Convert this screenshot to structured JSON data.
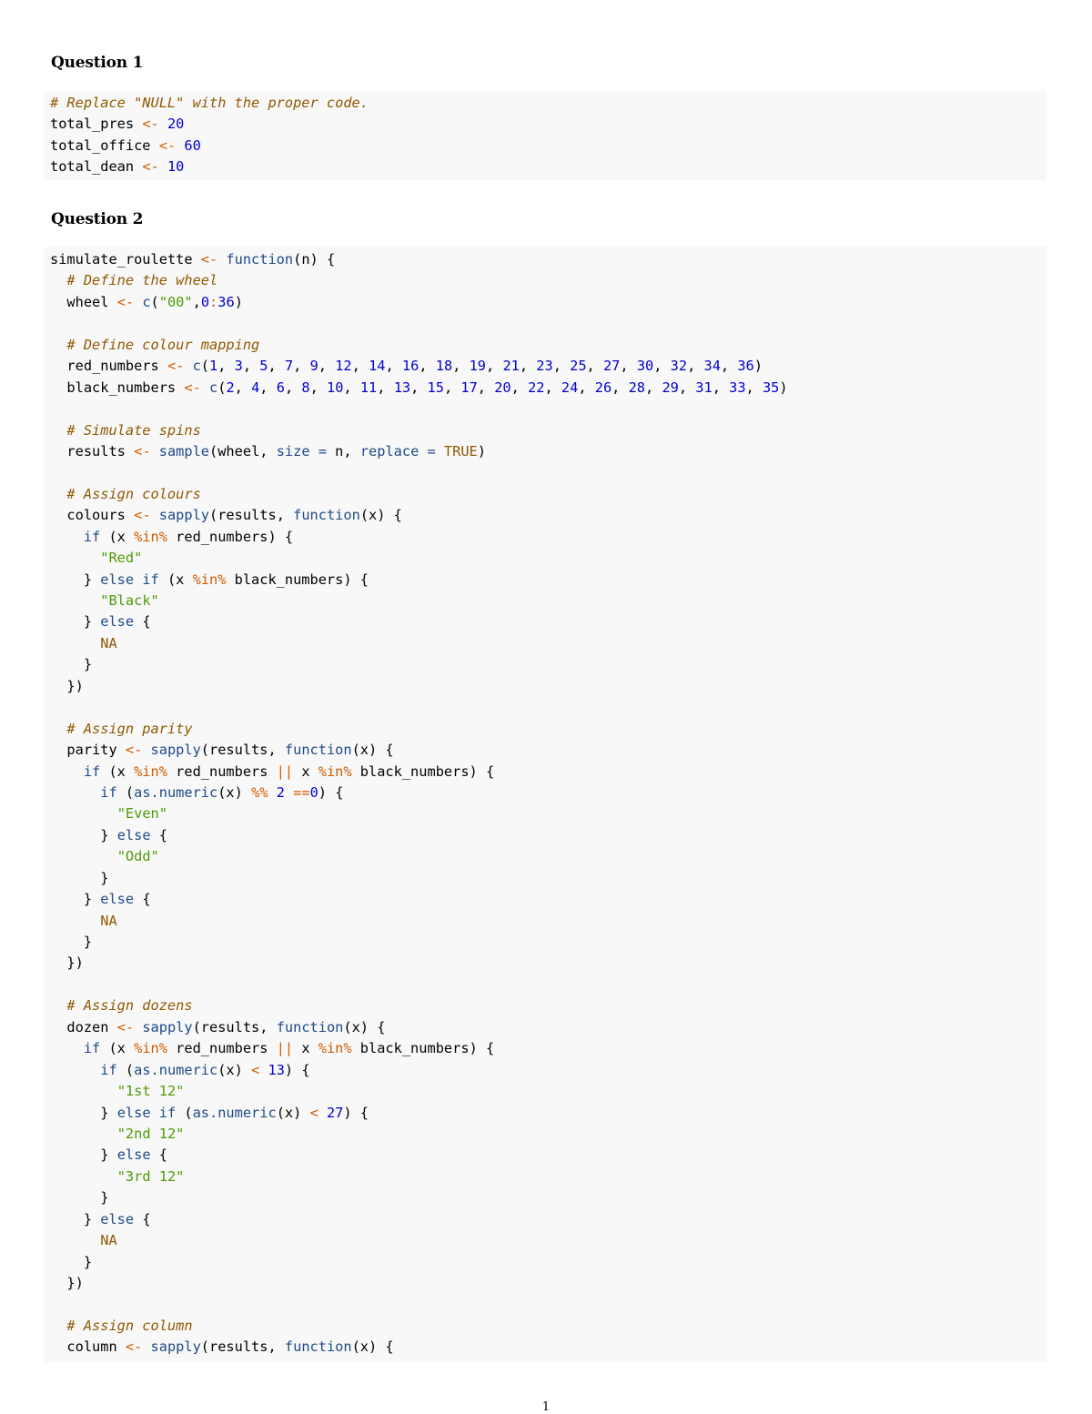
{
  "question1": {
    "heading": "Question 1",
    "code_lines": [
      [
        {
          "t": "c",
          "v": "# Replace \"NULL\" with the proper code."
        }
      ],
      [
        {
          "t": "p",
          "v": "total_pres "
        },
        {
          "t": "o",
          "v": "<-"
        },
        {
          "t": "p",
          "v": " "
        },
        {
          "t": "n",
          "v": "20"
        }
      ],
      [
        {
          "t": "p",
          "v": "total_office "
        },
        {
          "t": "o",
          "v": "<-"
        },
        {
          "t": "p",
          "v": " "
        },
        {
          "t": "n",
          "v": "60"
        }
      ],
      [
        {
          "t": "p",
          "v": "total_dean "
        },
        {
          "t": "o",
          "v": "<-"
        },
        {
          "t": "p",
          "v": " "
        },
        {
          "t": "n",
          "v": "10"
        }
      ]
    ]
  },
  "question2": {
    "heading": "Question 2",
    "code_lines": [
      [
        {
          "t": "p",
          "v": "simulate_roulette "
        },
        {
          "t": "o",
          "v": "<-"
        },
        {
          "t": "p",
          "v": " "
        },
        {
          "t": "k",
          "v": "function"
        },
        {
          "t": "p",
          "v": "(n) {"
        }
      ],
      [
        {
          "t": "p",
          "v": "  "
        },
        {
          "t": "c",
          "v": "# Define the wheel"
        }
      ],
      [
        {
          "t": "p",
          "v": "  wheel "
        },
        {
          "t": "o",
          "v": "<-"
        },
        {
          "t": "p",
          "v": " "
        },
        {
          "t": "f",
          "v": "c"
        },
        {
          "t": "p",
          "v": "("
        },
        {
          "t": "s",
          "v": "\"00\""
        },
        {
          "t": "p",
          "v": ","
        },
        {
          "t": "n",
          "v": "0"
        },
        {
          "t": "o",
          "v": ":"
        },
        {
          "t": "n",
          "v": "36"
        },
        {
          "t": "p",
          "v": ")"
        }
      ],
      [],
      [
        {
          "t": "p",
          "v": "  "
        },
        {
          "t": "c",
          "v": "# Define colour mapping"
        }
      ],
      [
        {
          "t": "p",
          "v": "  red_numbers "
        },
        {
          "t": "o",
          "v": "<-"
        },
        {
          "t": "p",
          "v": " "
        },
        {
          "t": "f",
          "v": "c"
        },
        {
          "t": "p",
          "v": "("
        },
        {
          "t": "n",
          "v": "1"
        },
        {
          "t": "p",
          "v": ", "
        },
        {
          "t": "n",
          "v": "3"
        },
        {
          "t": "p",
          "v": ", "
        },
        {
          "t": "n",
          "v": "5"
        },
        {
          "t": "p",
          "v": ", "
        },
        {
          "t": "n",
          "v": "7"
        },
        {
          "t": "p",
          "v": ", "
        },
        {
          "t": "n",
          "v": "9"
        },
        {
          "t": "p",
          "v": ", "
        },
        {
          "t": "n",
          "v": "12"
        },
        {
          "t": "p",
          "v": ", "
        },
        {
          "t": "n",
          "v": "14"
        },
        {
          "t": "p",
          "v": ", "
        },
        {
          "t": "n",
          "v": "16"
        },
        {
          "t": "p",
          "v": ", "
        },
        {
          "t": "n",
          "v": "18"
        },
        {
          "t": "p",
          "v": ", "
        },
        {
          "t": "n",
          "v": "19"
        },
        {
          "t": "p",
          "v": ", "
        },
        {
          "t": "n",
          "v": "21"
        },
        {
          "t": "p",
          "v": ", "
        },
        {
          "t": "n",
          "v": "23"
        },
        {
          "t": "p",
          "v": ", "
        },
        {
          "t": "n",
          "v": "25"
        },
        {
          "t": "p",
          "v": ", "
        },
        {
          "t": "n",
          "v": "27"
        },
        {
          "t": "p",
          "v": ", "
        },
        {
          "t": "n",
          "v": "30"
        },
        {
          "t": "p",
          "v": ", "
        },
        {
          "t": "n",
          "v": "32"
        },
        {
          "t": "p",
          "v": ", "
        },
        {
          "t": "n",
          "v": "34"
        },
        {
          "t": "p",
          "v": ", "
        },
        {
          "t": "n",
          "v": "36"
        },
        {
          "t": "p",
          "v": ")"
        }
      ],
      [
        {
          "t": "p",
          "v": "  black_numbers "
        },
        {
          "t": "o",
          "v": "<-"
        },
        {
          "t": "p",
          "v": " "
        },
        {
          "t": "f",
          "v": "c"
        },
        {
          "t": "p",
          "v": "("
        },
        {
          "t": "n",
          "v": "2"
        },
        {
          "t": "p",
          "v": ", "
        },
        {
          "t": "n",
          "v": "4"
        },
        {
          "t": "p",
          "v": ", "
        },
        {
          "t": "n",
          "v": "6"
        },
        {
          "t": "p",
          "v": ", "
        },
        {
          "t": "n",
          "v": "8"
        },
        {
          "t": "p",
          "v": ", "
        },
        {
          "t": "n",
          "v": "10"
        },
        {
          "t": "p",
          "v": ", "
        },
        {
          "t": "n",
          "v": "11"
        },
        {
          "t": "p",
          "v": ", "
        },
        {
          "t": "n",
          "v": "13"
        },
        {
          "t": "p",
          "v": ", "
        },
        {
          "t": "n",
          "v": "15"
        },
        {
          "t": "p",
          "v": ", "
        },
        {
          "t": "n",
          "v": "17"
        },
        {
          "t": "p",
          "v": ", "
        },
        {
          "t": "n",
          "v": "20"
        },
        {
          "t": "p",
          "v": ", "
        },
        {
          "t": "n",
          "v": "22"
        },
        {
          "t": "p",
          "v": ", "
        },
        {
          "t": "n",
          "v": "24"
        },
        {
          "t": "p",
          "v": ", "
        },
        {
          "t": "n",
          "v": "26"
        },
        {
          "t": "p",
          "v": ", "
        },
        {
          "t": "n",
          "v": "28"
        },
        {
          "t": "p",
          "v": ", "
        },
        {
          "t": "n",
          "v": "29"
        },
        {
          "t": "p",
          "v": ", "
        },
        {
          "t": "n",
          "v": "31"
        },
        {
          "t": "p",
          "v": ", "
        },
        {
          "t": "n",
          "v": "33"
        },
        {
          "t": "p",
          "v": ", "
        },
        {
          "t": "n",
          "v": "35"
        },
        {
          "t": "p",
          "v": ")"
        }
      ],
      [],
      [
        {
          "t": "p",
          "v": "  "
        },
        {
          "t": "c",
          "v": "# Simulate spins"
        }
      ],
      [
        {
          "t": "p",
          "v": "  results "
        },
        {
          "t": "o",
          "v": "<-"
        },
        {
          "t": "p",
          "v": " "
        },
        {
          "t": "f",
          "v": "sample"
        },
        {
          "t": "p",
          "v": "(wheel, "
        },
        {
          "t": "a",
          "v": "size ="
        },
        {
          "t": "p",
          "v": " n, "
        },
        {
          "t": "a",
          "v": "replace ="
        },
        {
          "t": "p",
          "v": " "
        },
        {
          "t": "t",
          "v": "TRUE"
        },
        {
          "t": "p",
          "v": ")"
        }
      ],
      [],
      [
        {
          "t": "p",
          "v": "  "
        },
        {
          "t": "c",
          "v": "# Assign colours"
        }
      ],
      [
        {
          "t": "p",
          "v": "  colours "
        },
        {
          "t": "o",
          "v": "<-"
        },
        {
          "t": "p",
          "v": " "
        },
        {
          "t": "f",
          "v": "sapply"
        },
        {
          "t": "p",
          "v": "(results, "
        },
        {
          "t": "k",
          "v": "function"
        },
        {
          "t": "p",
          "v": "(x) {"
        }
      ],
      [
        {
          "t": "p",
          "v": "    "
        },
        {
          "t": "k",
          "v": "if"
        },
        {
          "t": "p",
          "v": " (x "
        },
        {
          "t": "o",
          "v": "%in%"
        },
        {
          "t": "p",
          "v": " red_numbers) {"
        }
      ],
      [
        {
          "t": "p",
          "v": "      "
        },
        {
          "t": "s",
          "v": "\"Red\""
        }
      ],
      [
        {
          "t": "p",
          "v": "    } "
        },
        {
          "t": "k",
          "v": "else if"
        },
        {
          "t": "p",
          "v": " (x "
        },
        {
          "t": "o",
          "v": "%in%"
        },
        {
          "t": "p",
          "v": " black_numbers) {"
        }
      ],
      [
        {
          "t": "p",
          "v": "      "
        },
        {
          "t": "s",
          "v": "\"Black\""
        }
      ],
      [
        {
          "t": "p",
          "v": "    } "
        },
        {
          "t": "k",
          "v": "else"
        },
        {
          "t": "p",
          "v": " {"
        }
      ],
      [
        {
          "t": "p",
          "v": "      "
        },
        {
          "t": "na",
          "v": "NA"
        }
      ],
      [
        {
          "t": "p",
          "v": "    }"
        }
      ],
      [
        {
          "t": "p",
          "v": "  })"
        }
      ],
      [],
      [
        {
          "t": "p",
          "v": "  "
        },
        {
          "t": "c",
          "v": "# Assign parity"
        }
      ],
      [
        {
          "t": "p",
          "v": "  parity "
        },
        {
          "t": "o",
          "v": "<-"
        },
        {
          "t": "p",
          "v": " "
        },
        {
          "t": "f",
          "v": "sapply"
        },
        {
          "t": "p",
          "v": "(results, "
        },
        {
          "t": "k",
          "v": "function"
        },
        {
          "t": "p",
          "v": "(x) {"
        }
      ],
      [
        {
          "t": "p",
          "v": "    "
        },
        {
          "t": "k",
          "v": "if"
        },
        {
          "t": "p",
          "v": " (x "
        },
        {
          "t": "o",
          "v": "%in%"
        },
        {
          "t": "p",
          "v": " red_numbers "
        },
        {
          "t": "o",
          "v": "||"
        },
        {
          "t": "p",
          "v": " x "
        },
        {
          "t": "o",
          "v": "%in%"
        },
        {
          "t": "p",
          "v": " black_numbers) {"
        }
      ],
      [
        {
          "t": "p",
          "v": "      "
        },
        {
          "t": "k",
          "v": "if"
        },
        {
          "t": "p",
          "v": " ("
        },
        {
          "t": "f",
          "v": "as.numeric"
        },
        {
          "t": "p",
          "v": "(x) "
        },
        {
          "t": "o",
          "v": "%%"
        },
        {
          "t": "p",
          "v": " "
        },
        {
          "t": "n",
          "v": "2"
        },
        {
          "t": "p",
          "v": " "
        },
        {
          "t": "o",
          "v": "=="
        },
        {
          "t": "n",
          "v": "0"
        },
        {
          "t": "p",
          "v": ") {"
        }
      ],
      [
        {
          "t": "p",
          "v": "        "
        },
        {
          "t": "s",
          "v": "\"Even\""
        }
      ],
      [
        {
          "t": "p",
          "v": "      } "
        },
        {
          "t": "k",
          "v": "else"
        },
        {
          "t": "p",
          "v": " {"
        }
      ],
      [
        {
          "t": "p",
          "v": "        "
        },
        {
          "t": "s",
          "v": "\"Odd\""
        }
      ],
      [
        {
          "t": "p",
          "v": "      }"
        }
      ],
      [
        {
          "t": "p",
          "v": "    } "
        },
        {
          "t": "k",
          "v": "else"
        },
        {
          "t": "p",
          "v": " {"
        }
      ],
      [
        {
          "t": "p",
          "v": "      "
        },
        {
          "t": "na",
          "v": "NA"
        }
      ],
      [
        {
          "t": "p",
          "v": "    }"
        }
      ],
      [
        {
          "t": "p",
          "v": "  })"
        }
      ],
      [],
      [
        {
          "t": "p",
          "v": "  "
        },
        {
          "t": "c",
          "v": "# Assign dozens"
        }
      ],
      [
        {
          "t": "p",
          "v": "  dozen "
        },
        {
          "t": "o",
          "v": "<-"
        },
        {
          "t": "p",
          "v": " "
        },
        {
          "t": "f",
          "v": "sapply"
        },
        {
          "t": "p",
          "v": "(results, "
        },
        {
          "t": "k",
          "v": "function"
        },
        {
          "t": "p",
          "v": "(x) {"
        }
      ],
      [
        {
          "t": "p",
          "v": "    "
        },
        {
          "t": "k",
          "v": "if"
        },
        {
          "t": "p",
          "v": " (x "
        },
        {
          "t": "o",
          "v": "%in%"
        },
        {
          "t": "p",
          "v": " red_numbers "
        },
        {
          "t": "o",
          "v": "||"
        },
        {
          "t": "p",
          "v": " x "
        },
        {
          "t": "o",
          "v": "%in%"
        },
        {
          "t": "p",
          "v": " black_numbers) {"
        }
      ],
      [
        {
          "t": "p",
          "v": "      "
        },
        {
          "t": "k",
          "v": "if"
        },
        {
          "t": "p",
          "v": " ("
        },
        {
          "t": "f",
          "v": "as.numeric"
        },
        {
          "t": "p",
          "v": "(x) "
        },
        {
          "t": "o",
          "v": "<"
        },
        {
          "t": "p",
          "v": " "
        },
        {
          "t": "n",
          "v": "13"
        },
        {
          "t": "p",
          "v": ") {"
        }
      ],
      [
        {
          "t": "p",
          "v": "        "
        },
        {
          "t": "s",
          "v": "\"1st 12\""
        }
      ],
      [
        {
          "t": "p",
          "v": "      } "
        },
        {
          "t": "k",
          "v": "else if"
        },
        {
          "t": "p",
          "v": " ("
        },
        {
          "t": "f",
          "v": "as.numeric"
        },
        {
          "t": "p",
          "v": "(x) "
        },
        {
          "t": "o",
          "v": "<"
        },
        {
          "t": "p",
          "v": " "
        },
        {
          "t": "n",
          "v": "27"
        },
        {
          "t": "p",
          "v": ") {"
        }
      ],
      [
        {
          "t": "p",
          "v": "        "
        },
        {
          "t": "s",
          "v": "\"2nd 12\""
        }
      ],
      [
        {
          "t": "p",
          "v": "      } "
        },
        {
          "t": "k",
          "v": "else"
        },
        {
          "t": "p",
          "v": " {"
        }
      ],
      [
        {
          "t": "p",
          "v": "        "
        },
        {
          "t": "s",
          "v": "\"3rd 12\""
        }
      ],
      [
        {
          "t": "p",
          "v": "      }"
        }
      ],
      [
        {
          "t": "p",
          "v": "    } "
        },
        {
          "t": "k",
          "v": "else"
        },
        {
          "t": "p",
          "v": " {"
        }
      ],
      [
        {
          "t": "p",
          "v": "      "
        },
        {
          "t": "na",
          "v": "NA"
        }
      ],
      [
        {
          "t": "p",
          "v": "    }"
        }
      ],
      [
        {
          "t": "p",
          "v": "  })"
        }
      ],
      [],
      [
        {
          "t": "p",
          "v": "  "
        },
        {
          "t": "c",
          "v": "# Assign column"
        }
      ],
      [
        {
          "t": "p",
          "v": "  column "
        },
        {
          "t": "o",
          "v": "<-"
        },
        {
          "t": "p",
          "v": " "
        },
        {
          "t": "f",
          "v": "sapply"
        },
        {
          "t": "p",
          "v": "(results, "
        },
        {
          "t": "k",
          "v": "function"
        },
        {
          "t": "p",
          "v": "(x) {"
        }
      ]
    ]
  },
  "footer": {
    "page_number": "1"
  },
  "colors": {
    "code_background": "#f8f8f8",
    "comment": "#8f5902",
    "number": "#0000cf",
    "string": "#4e9a06",
    "keyword": "#204a87",
    "operator": "#ce5c00"
  }
}
